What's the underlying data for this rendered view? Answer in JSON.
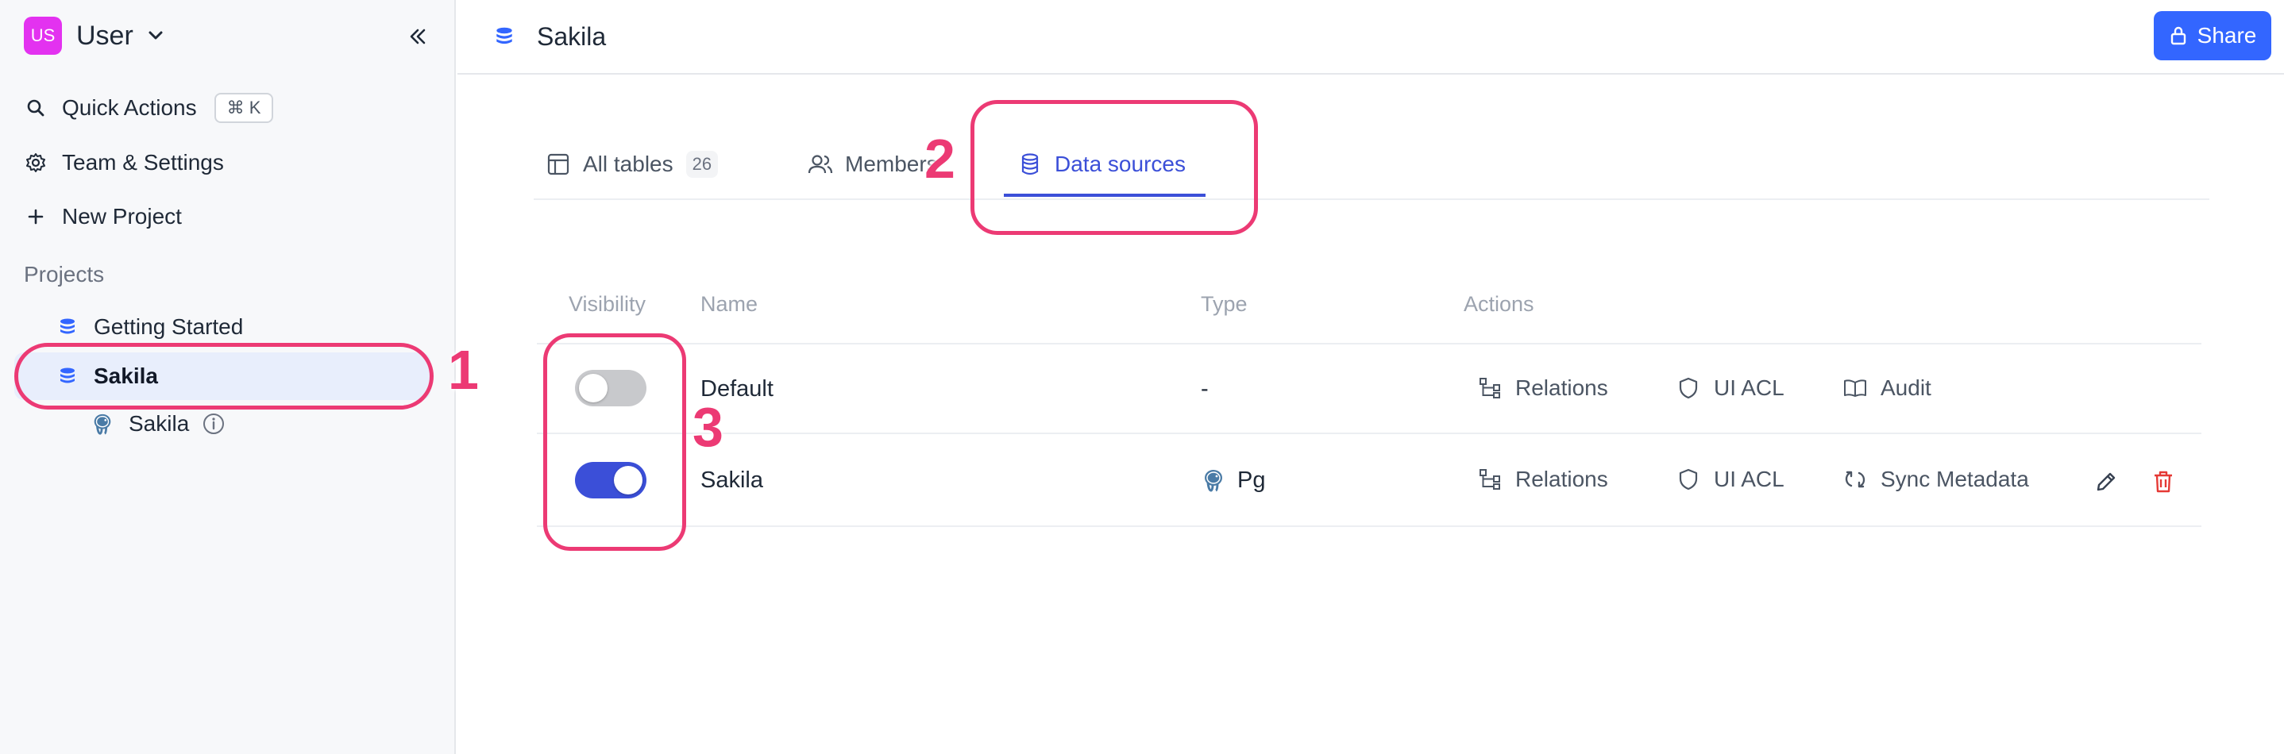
{
  "workspace": {
    "badge": "US",
    "name": "User"
  },
  "nav": {
    "quick_actions": "Quick Actions",
    "quick_actions_shortcut": "⌘ K",
    "team_settings": "Team & Settings",
    "new_project": "New Project"
  },
  "projects": {
    "label": "Projects",
    "items": [
      {
        "label": "Getting Started"
      },
      {
        "label": "Sakila"
      }
    ],
    "sub_items": [
      {
        "label": "Sakila"
      }
    ]
  },
  "header": {
    "title": "Sakila",
    "share_label": "Share"
  },
  "tabs": [
    {
      "label": "All tables",
      "count": "26"
    },
    {
      "label": "Members"
    },
    {
      "label": "Data sources"
    }
  ],
  "table": {
    "headers": {
      "visibility": "Visibility",
      "name": "Name",
      "type": "Type",
      "actions": "Actions"
    },
    "rows": [
      {
        "visible": false,
        "name": "Default",
        "type": "-",
        "actions": [
          "Relations",
          "UI ACL",
          "Audit"
        ]
      },
      {
        "visible": true,
        "name": "Sakila",
        "type": "Pg",
        "actions": [
          "Relations",
          "UI ACL",
          "Sync Metadata"
        ]
      }
    ]
  },
  "annotations": [
    "1",
    "2",
    "3"
  ],
  "colors": {
    "accent": "#3b4fd8",
    "brand": "#3366ff",
    "annotation": "#ec3a74",
    "badge": "#e332f0",
    "delete": "#e53935"
  },
  "icons": [
    "chevron-down-icon",
    "double-chevron-left-icon",
    "search-icon",
    "gear-icon",
    "plus-icon",
    "database-icon",
    "postgres-icon",
    "info-icon",
    "lock-icon",
    "table-icon",
    "users-icon",
    "relations-icon",
    "shield-icon",
    "book-icon",
    "sync-icon",
    "pencil-icon",
    "trash-icon"
  ]
}
